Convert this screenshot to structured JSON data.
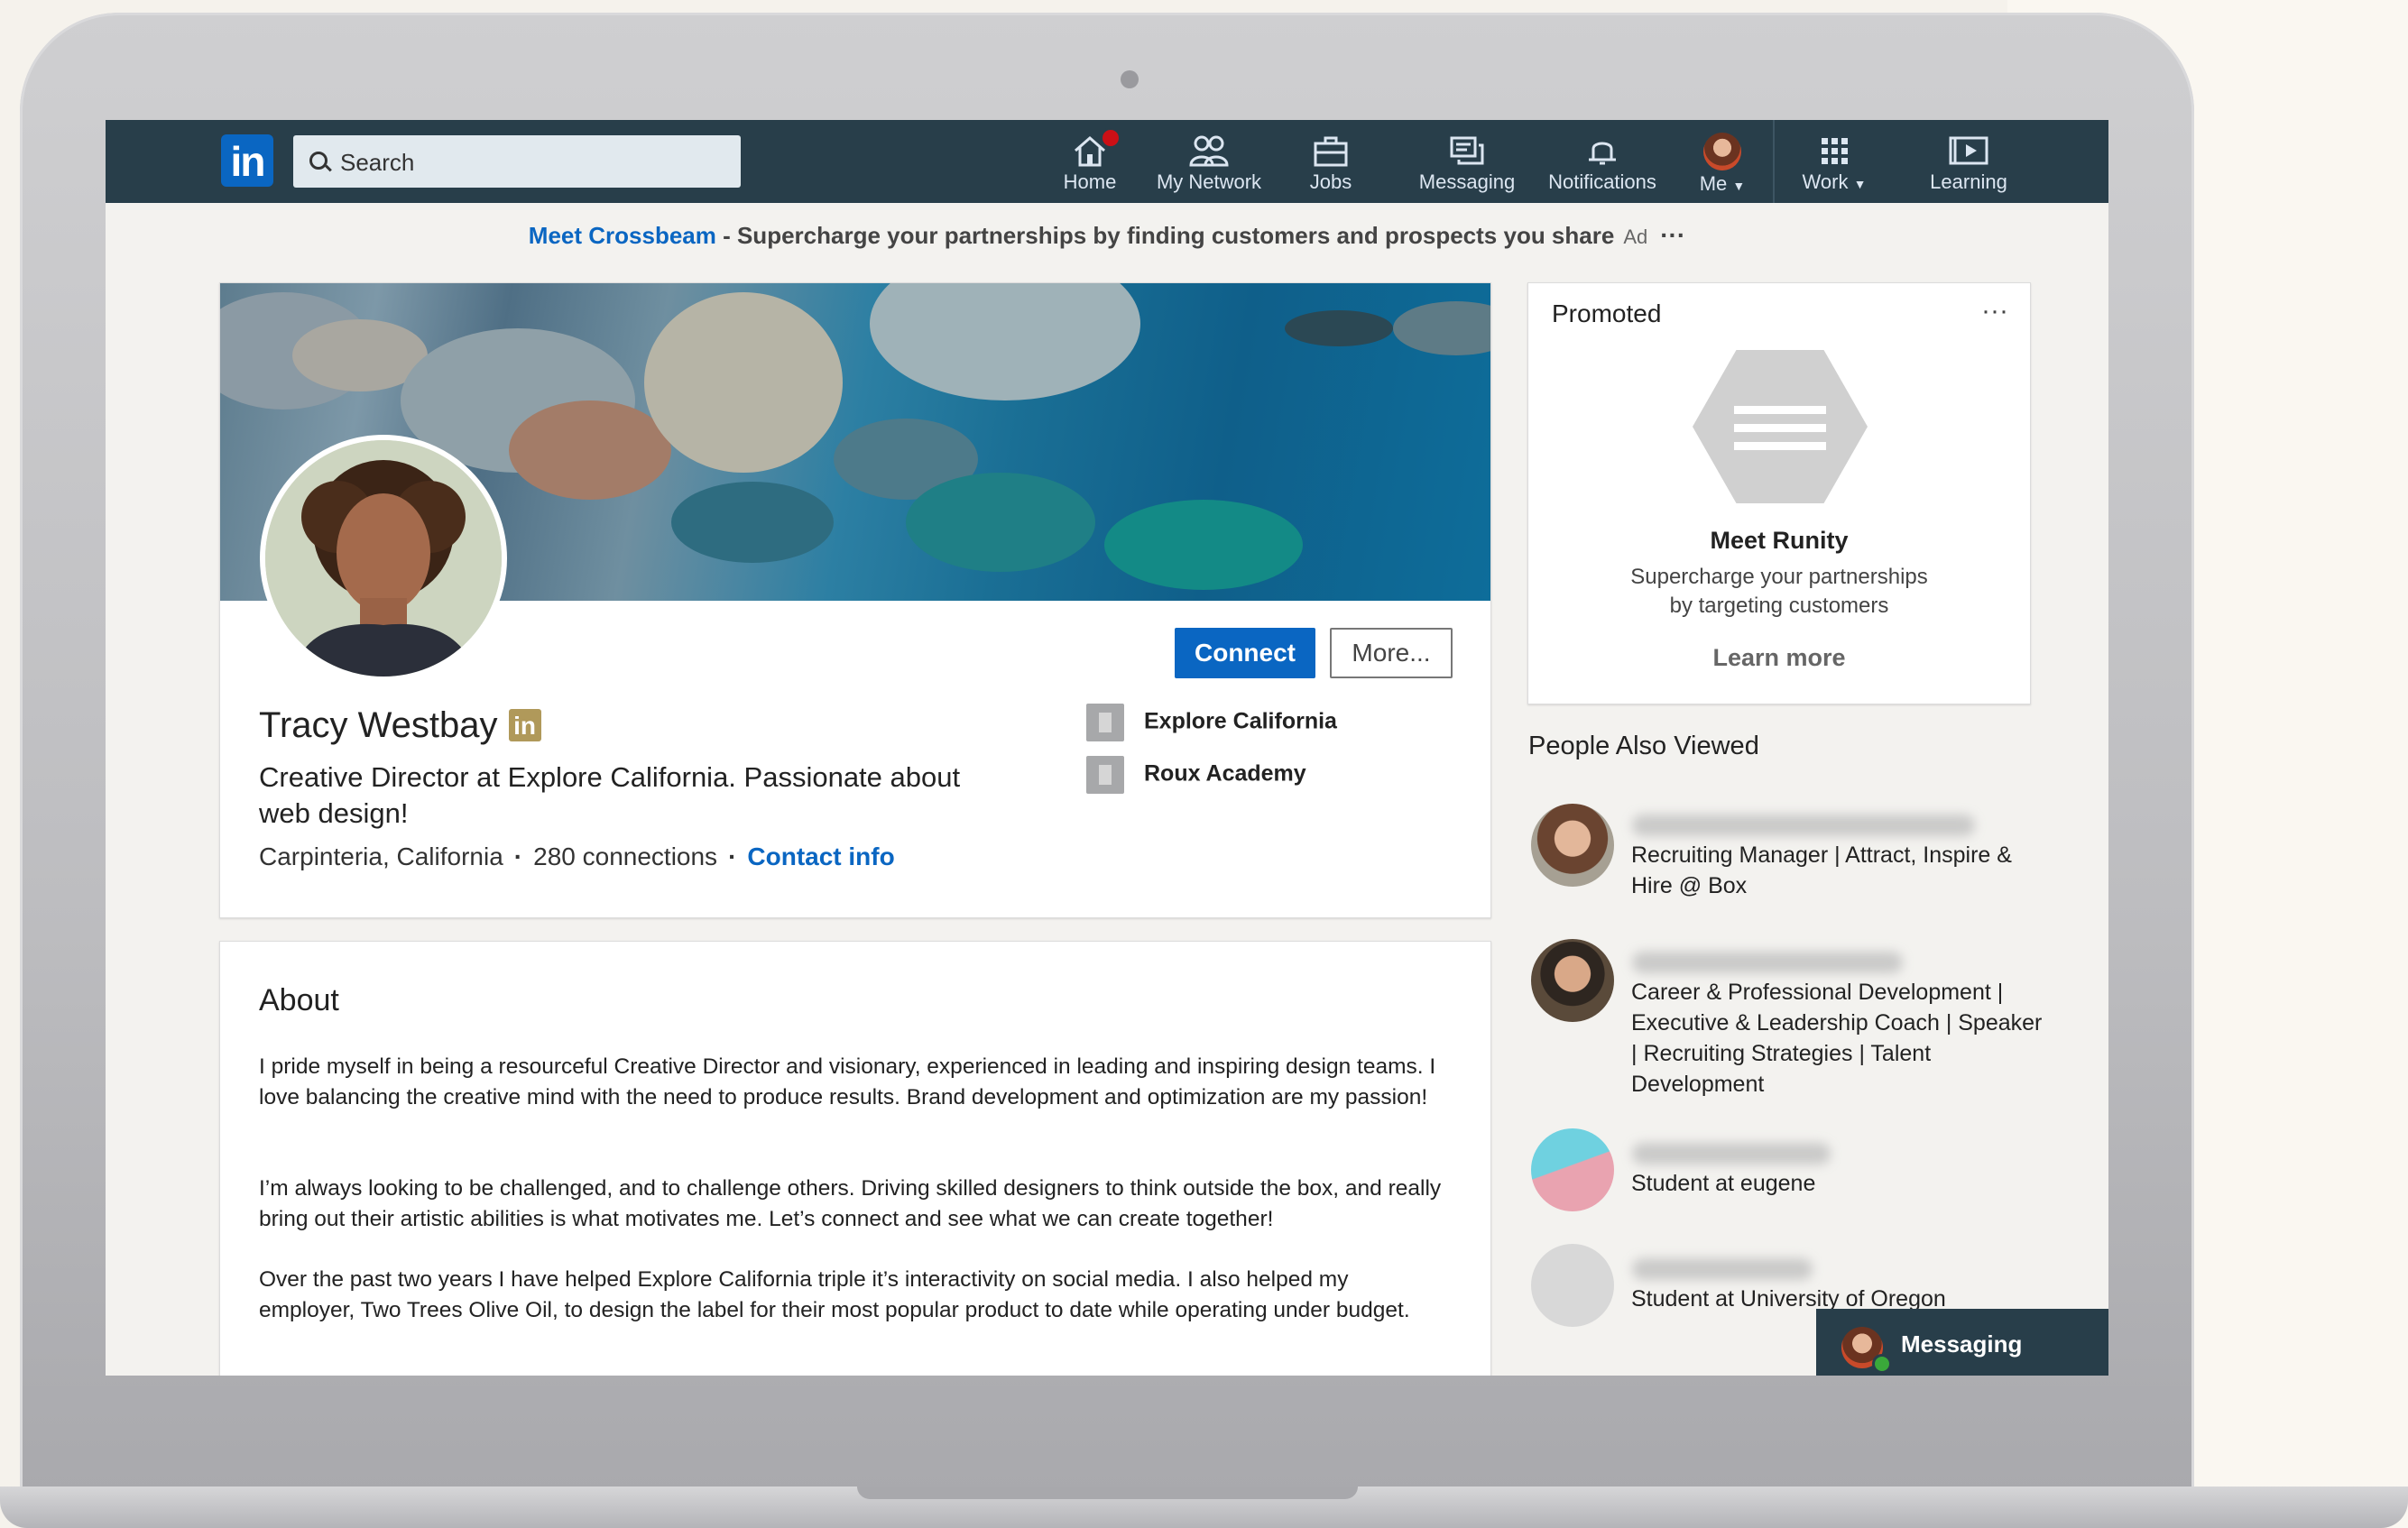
{
  "nav": {
    "search_placeholder": "Search",
    "items": [
      {
        "label": "Home"
      },
      {
        "label": "My Network"
      },
      {
        "label": "Jobs"
      },
      {
        "label": "Messaging"
      },
      {
        "label": "Notifications"
      },
      {
        "label": "Me"
      },
      {
        "label": "Work"
      },
      {
        "label": "Learning"
      }
    ]
  },
  "ad": {
    "link": "Meet Crossbeam",
    "text": " - Supercharge your partnerships by finding customers and prospects you share",
    "tag": "Ad",
    "more": "···"
  },
  "profile": {
    "connect_label": "Connect",
    "more_label": "More...",
    "name": "Tracy Westbay",
    "headline": "Creative Director at Explore California. Passionate about web design!",
    "location": "Carpinteria, California",
    "connections": "280 connections",
    "contact": "Contact info",
    "separator": "·",
    "companies": [
      "Explore California",
      "Roux Academy"
    ]
  },
  "about": {
    "title": "About",
    "paragraphs": [
      "I pride myself in being a resourceful Creative Director and visionary, experienced in leading and inspiring design teams. I love balancing the creative mind with the need to produce results. Brand development and optimization are my passion!",
      "I’m always looking to be challenged, and to challenge others. Driving skilled designers to think outside the box, and really bring out their artistic abilities is what motivates me. Let’s connect and see what we can create together!",
      "Over the past two years I have helped Explore California triple it’s interactivity on social media. I also helped my employer, Two Trees Olive Oil, to design the label for their most popular product to date while operating under budget."
    ]
  },
  "promoted": {
    "title": "Promoted",
    "more": "···",
    "name": "Meet Runity",
    "desc_line1": "Supercharge your partnerships",
    "desc_line2": "by targeting customers",
    "cta": "Learn more"
  },
  "people_also_viewed": {
    "title": "People Also Viewed",
    "people": [
      {
        "headline": "Recruiting Manager | Attract, Inspire & Hire @ Box"
      },
      {
        "headline": "Career & Professional Development | Executive & Leadership Coach | Speaker | Recruiting Strategies | Talent Development"
      },
      {
        "headline": "Student at eugene"
      },
      {
        "headline": "Student at University of Oregon"
      }
    ]
  },
  "messaging": {
    "label": "Messaging"
  },
  "colors": {
    "brand": "#0a66c2",
    "nav": "#283e4a",
    "badge": "#cc1016"
  }
}
